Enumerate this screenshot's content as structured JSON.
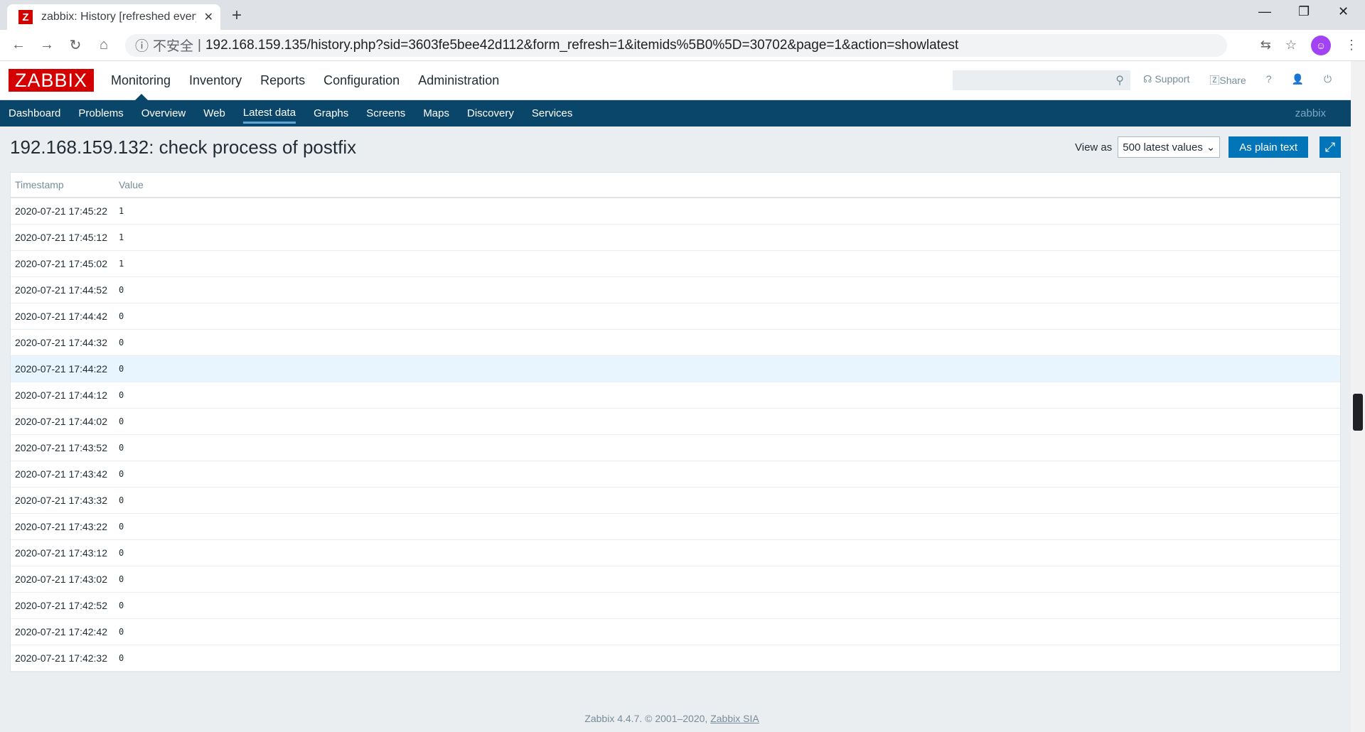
{
  "browser": {
    "tab_title": "zabbix: History [refreshed every",
    "tab_icon": "Z",
    "insecure_label": "不安全",
    "url_host": "192.168.159.135",
    "url_path": "/history.php?sid=3603fe5bee42d112&form_refresh=1&itemids%5B0%5D=30702&page=1&action=showlatest"
  },
  "top": {
    "logo": "ZABBIX",
    "menu": [
      "Monitoring",
      "Inventory",
      "Reports",
      "Configuration",
      "Administration"
    ],
    "support": "Support",
    "share": "Share",
    "help": "?"
  },
  "subnav": {
    "items": [
      "Dashboard",
      "Problems",
      "Overview",
      "Web",
      "Latest data",
      "Graphs",
      "Screens",
      "Maps",
      "Discovery",
      "Services"
    ],
    "active": "Latest data",
    "user": "zabbix"
  },
  "page": {
    "title": "192.168.159.132: check process of postfix",
    "view_as_label": "View as",
    "view_as_value": "500 latest values",
    "plain_text_button": "As plain text"
  },
  "table": {
    "headers": [
      "Timestamp",
      "Value"
    ],
    "rows": [
      {
        "ts": "2020-07-21 17:45:22",
        "val": "1"
      },
      {
        "ts": "2020-07-21 17:45:12",
        "val": "1"
      },
      {
        "ts": "2020-07-21 17:45:02",
        "val": "1"
      },
      {
        "ts": "2020-07-21 17:44:52",
        "val": "0"
      },
      {
        "ts": "2020-07-21 17:44:42",
        "val": "0"
      },
      {
        "ts": "2020-07-21 17:44:32",
        "val": "0"
      },
      {
        "ts": "2020-07-21 17:44:22",
        "val": "0"
      },
      {
        "ts": "2020-07-21 17:44:12",
        "val": "0"
      },
      {
        "ts": "2020-07-21 17:44:02",
        "val": "0"
      },
      {
        "ts": "2020-07-21 17:43:52",
        "val": "0"
      },
      {
        "ts": "2020-07-21 17:43:42",
        "val": "0"
      },
      {
        "ts": "2020-07-21 17:43:32",
        "val": "0"
      },
      {
        "ts": "2020-07-21 17:43:22",
        "val": "0"
      },
      {
        "ts": "2020-07-21 17:43:12",
        "val": "0"
      },
      {
        "ts": "2020-07-21 17:43:02",
        "val": "0"
      },
      {
        "ts": "2020-07-21 17:42:52",
        "val": "0"
      },
      {
        "ts": "2020-07-21 17:42:42",
        "val": "0"
      },
      {
        "ts": "2020-07-21 17:42:32",
        "val": "0"
      }
    ],
    "highlighted_row": 6
  },
  "footer": {
    "text": "Zabbix 4.4.7. © 2001–2020,",
    "link": "Zabbix SIA"
  }
}
